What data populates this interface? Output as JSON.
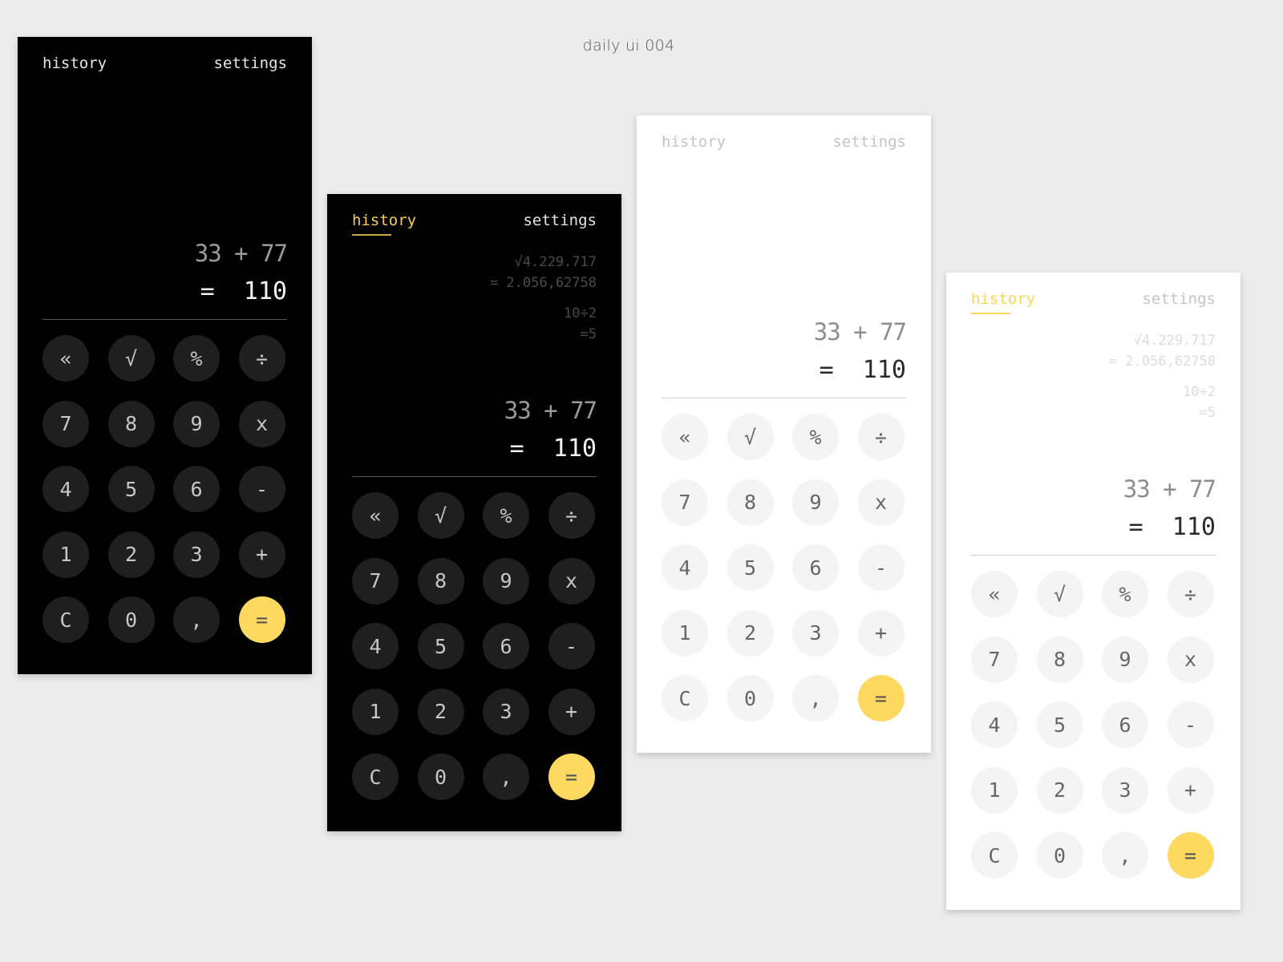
{
  "page_title": "daily ui 004",
  "accent_color": "#fed960",
  "keys": [
    "«",
    "√",
    "%",
    "÷",
    "7",
    "8",
    "9",
    "x",
    "4",
    "5",
    "6",
    "-",
    "1",
    "2",
    "3",
    "+",
    "C",
    "0",
    ",",
    "="
  ],
  "key_names": [
    "backspace",
    "sqrt",
    "percent",
    "divide",
    "seven",
    "eight",
    "nine",
    "multiply",
    "four",
    "five",
    "six",
    "minus",
    "one",
    "two",
    "three",
    "plus",
    "clear",
    "zero",
    "comma",
    "equals"
  ],
  "screens": [
    {
      "theme": "dark",
      "nav": {
        "history": "history",
        "settings": "settings",
        "active": ""
      },
      "history": [],
      "display": {
        "expression": "33 + 77",
        "result": "=  110"
      }
    },
    {
      "theme": "dark",
      "nav": {
        "history": "history",
        "settings": "settings",
        "active": "history"
      },
      "history": [
        {
          "expression": "√4.229.717",
          "result": "= 2.056,62758"
        },
        {
          "expression": "10÷2",
          "result": "=5"
        }
      ],
      "display": {
        "expression": "33 + 77",
        "result": "=  110"
      }
    },
    {
      "theme": "light",
      "nav": {
        "history": "history",
        "settings": "settings",
        "active": ""
      },
      "history": [],
      "display": {
        "expression": "33 + 77",
        "result": "=  110"
      }
    },
    {
      "theme": "light",
      "nav": {
        "history": "history",
        "settings": "settings",
        "active": "history"
      },
      "history": [
        {
          "expression": "√4.229.717",
          "result": "= 2.056,62758"
        },
        {
          "expression": "10÷2",
          "result": "=5"
        }
      ],
      "display": {
        "expression": "33 + 77",
        "result": "=  110"
      }
    }
  ]
}
